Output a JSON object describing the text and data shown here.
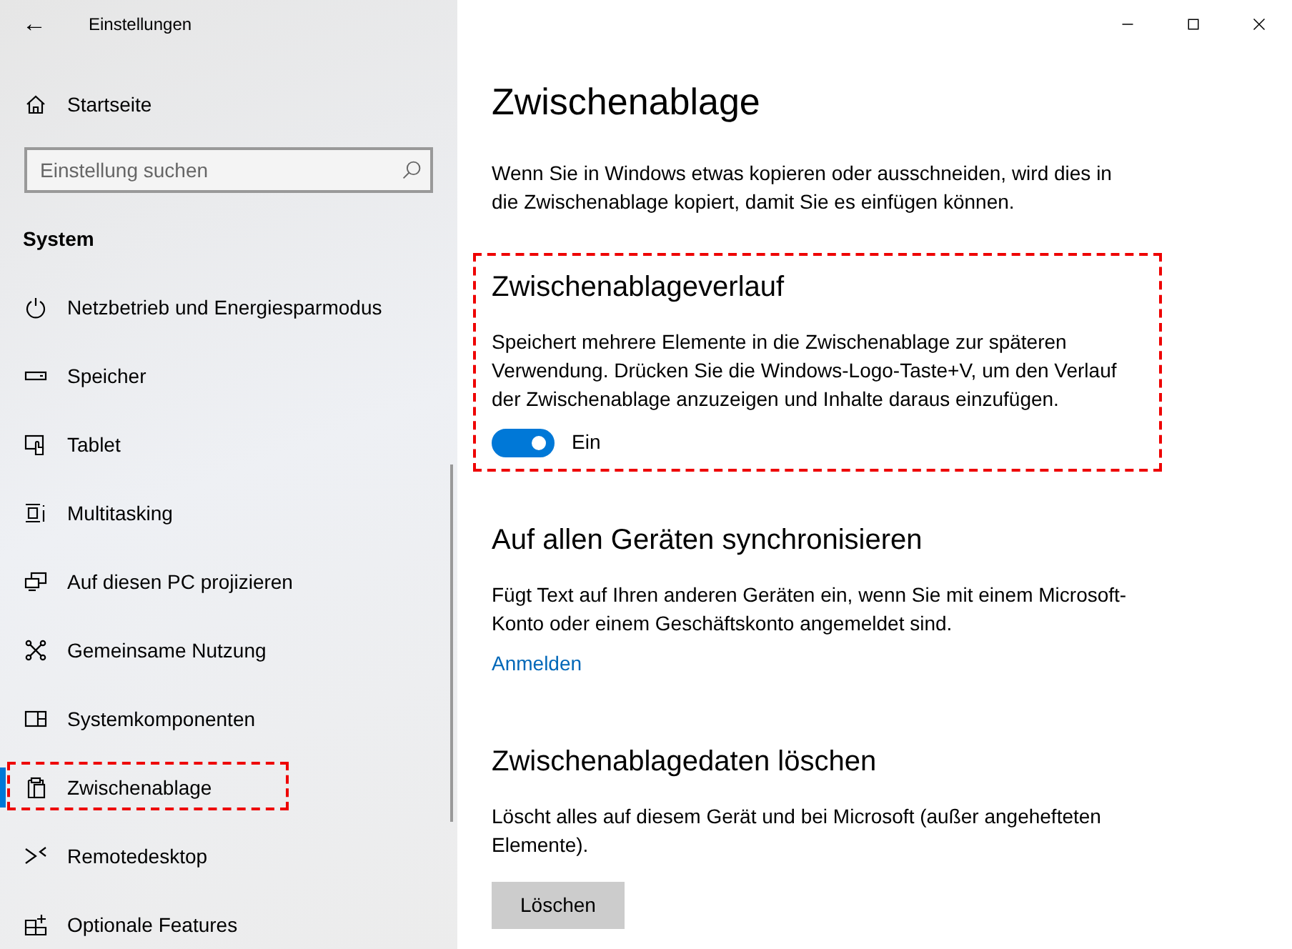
{
  "window": {
    "title": "Einstellungen",
    "back": "←"
  },
  "sidebar": {
    "home": {
      "label": "Startseite"
    },
    "search": {
      "placeholder": "Einstellung suchen"
    },
    "group": "System",
    "items": [
      {
        "label": "Netzbetrieb und Energiesparmodus",
        "selected": false,
        "highlighted": false
      },
      {
        "label": "Speicher",
        "selected": false,
        "highlighted": false
      },
      {
        "label": "Tablet",
        "selected": false,
        "highlighted": false
      },
      {
        "label": "Multitasking",
        "selected": false,
        "highlighted": false
      },
      {
        "label": "Auf diesen PC projizieren",
        "selected": false,
        "highlighted": false
      },
      {
        "label": "Gemeinsame Nutzung",
        "selected": false,
        "highlighted": false
      },
      {
        "label": "Systemkomponenten",
        "selected": false,
        "highlighted": false
      },
      {
        "label": "Zwischenablage",
        "selected": true,
        "highlighted": true
      },
      {
        "label": "Remotedesktop",
        "selected": false,
        "highlighted": false
      },
      {
        "label": "Optionale Features",
        "selected": false,
        "highlighted": false
      }
    ]
  },
  "page": {
    "title": "Zwischenablage",
    "intro": "Wenn Sie in Windows etwas kopieren oder ausschneiden, wird dies in die Zwischenablage kopiert, damit Sie es einfügen können.",
    "sections": [
      {
        "kind": "toggle",
        "heading": "Zwischenablageverlauf",
        "text": "Speichert mehrere Elemente in die Zwischenablage zur späteren Verwendung. Drücken Sie die Windows-Logo-Taste+V, um den Verlauf der Zwischenablage anzuzeigen und Inhalte daraus einzufügen.",
        "on": true,
        "state_label": "Ein",
        "highlighted": true
      },
      {
        "kind": "link",
        "heading": "Auf allen Geräten synchronisieren",
        "text": "Fügt Text auf Ihren anderen Geräten ein, wenn Sie mit einem Microsoft-Konto oder einem Geschäftskonto angemeldet sind.",
        "action": "Anmelden",
        "highlighted": false
      },
      {
        "kind": "button",
        "heading": "Zwischenablagedaten löschen",
        "text": "Löscht alles auf diesem Gerät und bei Microsoft (außer angehefteten Elemente).",
        "action": "Löschen",
        "highlighted": false
      }
    ]
  }
}
